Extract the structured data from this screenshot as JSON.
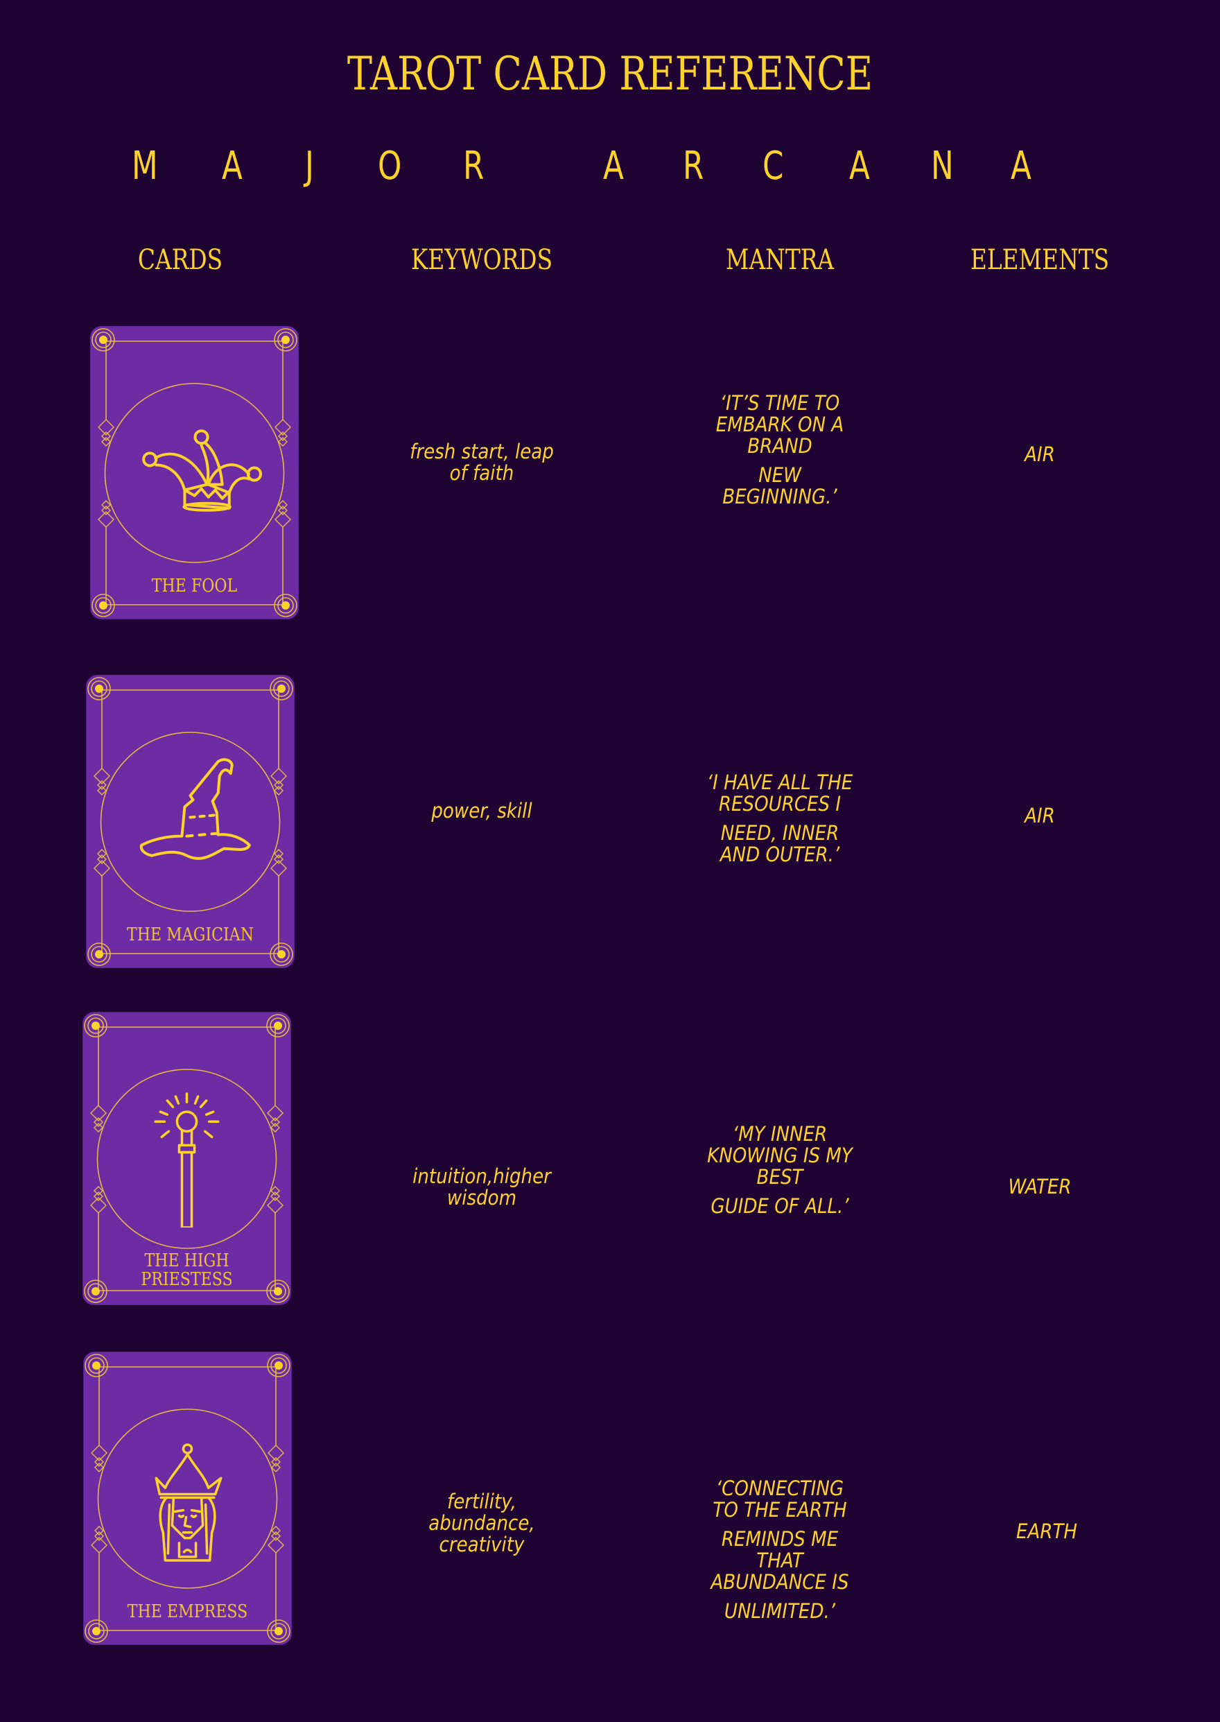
{
  "title": "TAROT CARD REFERENCE",
  "subtitle": {
    "text": "MAJOR ARCANA",
    "letters": [
      "M",
      "A",
      "J",
      "O",
      "R",
      "A",
      "R",
      "C",
      "A",
      "N",
      "A"
    ]
  },
  "columns": {
    "cards": "CARDS",
    "keywords": "KEYWORDS",
    "mantra": "MANTRA",
    "elements": "ELEMENTS"
  },
  "colors": {
    "background": "#1f0333",
    "card_fill": "#6d2ca4",
    "gold": "#fdd22a",
    "frame_line": "#e8b840"
  },
  "rows": [
    {
      "card_name": [
        "THE FOOL"
      ],
      "icon": "jester-hat-icon",
      "keywords": [
        "fresh start, leap",
        "of faith"
      ],
      "mantra": [
        [
          "‘IT’S TIME TO",
          "EMBARK ON A",
          "BRAND"
        ],
        [
          "NEW",
          "BEGINNING.’"
        ]
      ],
      "element": "AIR"
    },
    {
      "card_name": [
        "THE MAGICIAN"
      ],
      "icon": "wizard-hat-icon",
      "keywords": [
        "power, skill"
      ],
      "mantra": [
        [
          "‘I HAVE ALL THE",
          "RESOURCES I"
        ],
        [
          "NEED, INNER",
          "AND OUTER.’"
        ]
      ],
      "element": "AIR"
    },
    {
      "card_name": [
        "THE HIGH",
        "PRIESTESS"
      ],
      "icon": "scepter-icon",
      "keywords": [
        "intuition,higher",
        "wisdom"
      ],
      "mantra": [
        [
          "‘MY INNER",
          "KNOWING IS MY",
          "BEST"
        ],
        [
          "GUIDE OF ALL.’"
        ]
      ],
      "element": "WATER"
    },
    {
      "card_name": [
        "THE EMPRESS"
      ],
      "icon": "crowned-queen-icon",
      "keywords": [
        "fertility,",
        "abundance,",
        "creativity"
      ],
      "mantra": [
        [
          "‘CONNECTING",
          "TO THE EARTH"
        ],
        [
          "REMINDS ME",
          "THAT",
          "ABUNDANCE IS"
        ],
        [
          "UNLIMITED.’"
        ]
      ],
      "element": "EARTH"
    }
  ]
}
